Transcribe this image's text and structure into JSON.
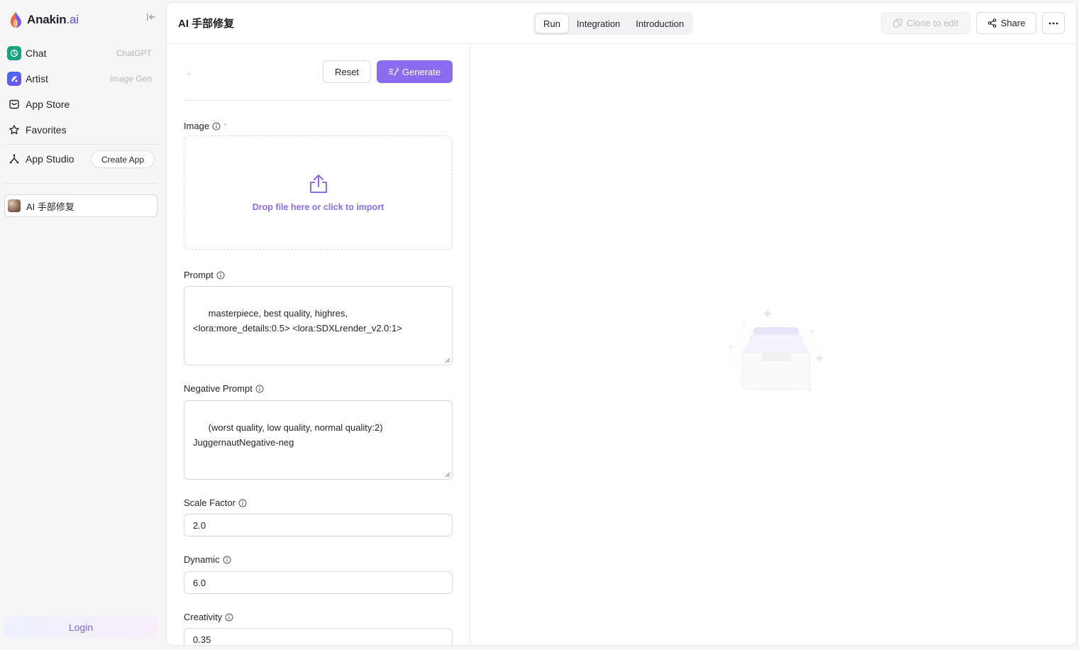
{
  "brand": {
    "name": "Anakin",
    "suffix": ".ai"
  },
  "sidebar": {
    "items": [
      {
        "label": "Chat",
        "hint": "ChatGPT"
      },
      {
        "label": "Artist",
        "hint": "Image Gen"
      },
      {
        "label": "App Store"
      },
      {
        "label": "Favorites"
      },
      {
        "label": "App Studio"
      }
    ],
    "create_app_label": "Create App",
    "recent_app_label": "AI 手部修复",
    "login_label": "Login"
  },
  "header": {
    "title": "AI 手部修复",
    "tabs": [
      {
        "label": "Run",
        "active": true
      },
      {
        "label": "Integration"
      },
      {
        "label": "Introduction"
      }
    ],
    "clone_label": "Clone to edit",
    "share_label": "Share"
  },
  "form": {
    "reset_label": "Reset",
    "generate_label": "Generate",
    "image_label": "Image",
    "image_required_mark": "*",
    "dropzone_text": "Drop file here or click to import",
    "prompt_label": "Prompt",
    "prompt_value": "masterpiece, best quality, highres,\n<lora:more_details:0.5> <lora:SDXLrender_v2.0:1>",
    "negative_label": "Negative Prompt",
    "negative_value": "(worst quality, low quality, normal quality:2)\nJuggernautNegative-neg",
    "scale_label": "Scale Factor",
    "scale_value": "2.0",
    "dynamic_label": "Dynamic",
    "dynamic_value": "6.0",
    "creativity_label": "Creativity",
    "creativity_value": "0.35"
  },
  "colors": {
    "accent": "#8b6cf0",
    "brand": "#5b4bd3",
    "chat_icon": "#19a37f"
  }
}
